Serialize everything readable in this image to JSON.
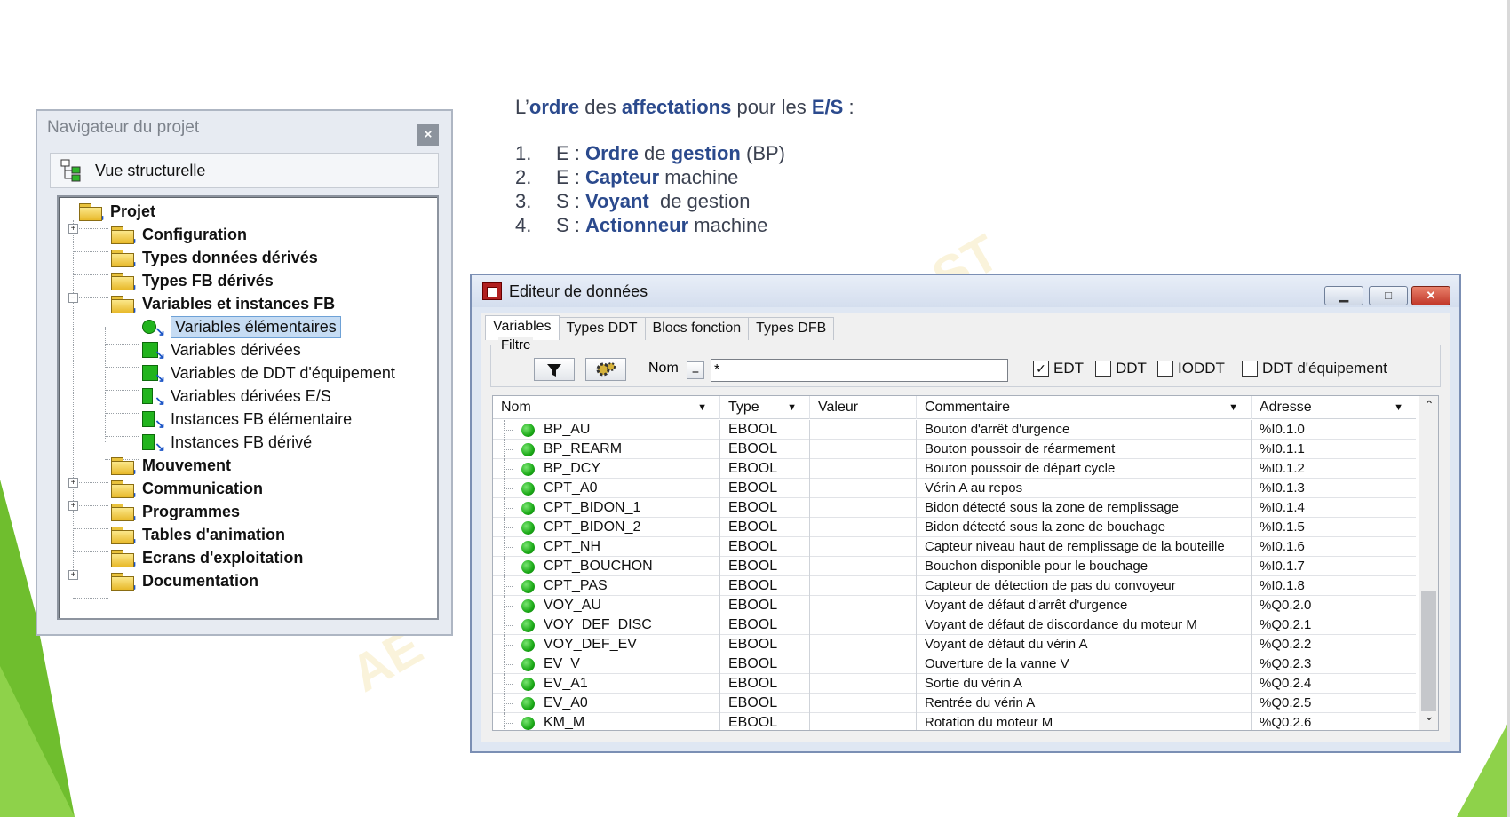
{
  "intro": {
    "heading": [
      "L’",
      "ordre",
      " des ",
      "affectations",
      " pour les ",
      "E/S",
      " :"
    ],
    "items": [
      {
        "num": "1.",
        "parts": [
          "E : ",
          "Ordre",
          " de ",
          "gestion",
          " (BP)"
        ]
      },
      {
        "num": "2.",
        "parts": [
          "E : ",
          "Capteur",
          " machine",
          "",
          ""
        ]
      },
      {
        "num": "3.",
        "parts": [
          "S : ",
          "Voyant",
          "  de gestion",
          "",
          ""
        ]
      },
      {
        "num": "4.",
        "parts": [
          "S : ",
          "Actionneur",
          " machine",
          "",
          ""
        ]
      }
    ]
  },
  "navigator": {
    "title": "Navigateur du projet",
    "close": "×",
    "view": "Vue structurelle",
    "tree": [
      {
        "label": "Projet",
        "bold": true
      },
      {
        "label": "Configuration",
        "bold": true
      },
      {
        "label": "Types données dérivés",
        "bold": true
      },
      {
        "label": "Types FB dérivés",
        "bold": true
      },
      {
        "label": "Variables et instances FB",
        "bold": true
      },
      {
        "label": "Variables élémentaires",
        "bold": false
      },
      {
        "label": "Variables dérivées",
        "bold": false
      },
      {
        "label": "Variables de DDT d'équipement",
        "bold": false
      },
      {
        "label": "Variables dérivées E/S",
        "bold": false
      },
      {
        "label": "Instances FB élémentaire",
        "bold": false
      },
      {
        "label": "Instances FB dérivé",
        "bold": false
      },
      {
        "label": "Mouvement",
        "bold": true
      },
      {
        "label": "Communication",
        "bold": true
      },
      {
        "label": "Programmes",
        "bold": true
      },
      {
        "label": "Tables d'animation",
        "bold": true
      },
      {
        "label": "Ecrans d'exploitation",
        "bold": true
      },
      {
        "label": "Documentation",
        "bold": true
      }
    ]
  },
  "editor": {
    "title": "Editeur de données",
    "tabs": [
      "Variables",
      "Types DDT",
      "Blocs fonction",
      "Types DFB"
    ],
    "filter_label": "Filtre",
    "name_label": "Nom",
    "equals": "=",
    "filter_value": "*",
    "checks": [
      {
        "label": "EDT",
        "checked": true
      },
      {
        "label": "DDT",
        "checked": false
      },
      {
        "label": "IODDT",
        "checked": false
      },
      {
        "label": "DDT d'équipement",
        "checked": false
      }
    ],
    "columns": [
      "Nom",
      "Type",
      "Valeur",
      "Commentaire",
      "Adresse"
    ],
    "rows": [
      {
        "name": "BP_AU",
        "type": "EBOOL",
        "value": "",
        "comment": "Bouton d'arrêt d'urgence",
        "address": "%I0.1.0"
      },
      {
        "name": "BP_REARM",
        "type": "EBOOL",
        "value": "",
        "comment": "Bouton poussoir de réarmement",
        "address": "%I0.1.1"
      },
      {
        "name": "BP_DCY",
        "type": "EBOOL",
        "value": "",
        "comment": "Bouton poussoir de départ cycle",
        "address": "%I0.1.2"
      },
      {
        "name": "CPT_A0",
        "type": "EBOOL",
        "value": "",
        "comment": "Vérin A au repos",
        "address": "%I0.1.3"
      },
      {
        "name": "CPT_BIDON_1",
        "type": "EBOOL",
        "value": "",
        "comment": "Bidon détecté sous la zone de remplissage",
        "address": "%I0.1.4"
      },
      {
        "name": "CPT_BIDON_2",
        "type": "EBOOL",
        "value": "",
        "comment": "Bidon détecté sous la zone de bouchage",
        "address": "%I0.1.5"
      },
      {
        "name": "CPT_NH",
        "type": "EBOOL",
        "value": "",
        "comment": "Capteur niveau haut de remplissage de la bouteille",
        "address": "%I0.1.6"
      },
      {
        "name": "CPT_BOUCHON",
        "type": "EBOOL",
        "value": "",
        "comment": "Bouchon disponible pour le bouchage",
        "address": "%I0.1.7"
      },
      {
        "name": "CPT_PAS",
        "type": "EBOOL",
        "value": "",
        "comment": "Capteur de détection de pas du convoyeur",
        "address": "%I0.1.8"
      },
      {
        "name": "VOY_AU",
        "type": "EBOOL",
        "value": "",
        "comment": "Voyant de défaut d'arrêt d'urgence",
        "address": "%Q0.2.0"
      },
      {
        "name": "VOY_DEF_DISC",
        "type": "EBOOL",
        "value": "",
        "comment": "Voyant de défaut de discordance du moteur M",
        "address": "%Q0.2.1"
      },
      {
        "name": "VOY_DEF_EV",
        "type": "EBOOL",
        "value": "",
        "comment": "Voyant de défaut du vérin A",
        "address": "%Q0.2.2"
      },
      {
        "name": "EV_V",
        "type": "EBOOL",
        "value": "",
        "comment": "Ouverture de la vanne V",
        "address": "%Q0.2.3"
      },
      {
        "name": "EV_A1",
        "type": "EBOOL",
        "value": "",
        "comment": "Sortie du vérin A",
        "address": "%Q0.2.4"
      },
      {
        "name": "EV_A0",
        "type": "EBOOL",
        "value": "",
        "comment": "Rentrée du vérin A",
        "address": "%Q0.2.5"
      },
      {
        "name": "KM_M",
        "type": "EBOOL",
        "value": "",
        "comment": "Rotation du moteur M",
        "address": "%Q0.2.6"
      }
    ]
  },
  "colors": {
    "accent_text": "#2b4a8d",
    "slide_green": "#6fbe2e",
    "selection": "#c6dcf3"
  }
}
